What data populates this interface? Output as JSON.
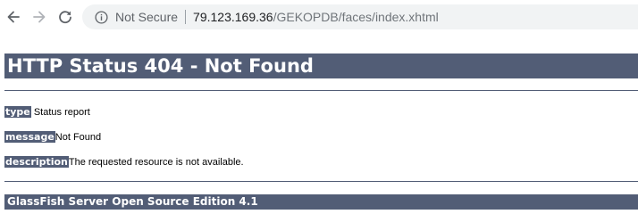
{
  "browser": {
    "security_label": "Not Secure",
    "url_host": "79.123.169.36",
    "url_path": "/GEKOPDB/faces/index.xhtml",
    "icons": {
      "back": "back-arrow-icon",
      "forward": "forward-arrow-icon",
      "reload": "reload-icon",
      "info": "info-icon"
    }
  },
  "page": {
    "title": "HTTP Status 404 - Not Found",
    "rows": [
      {
        "label": "type",
        "text": " Status report"
      },
      {
        "label": "message",
        "text": "Not Found"
      },
      {
        "label": "description",
        "text": "The requested resource is not available."
      }
    ],
    "server": "GlassFish Server Open Source Edition 4.1"
  },
  "colors": {
    "header_bg": "#525d76",
    "header_text": "#ffffff",
    "omnibox_bg": "#f1f3f4"
  }
}
